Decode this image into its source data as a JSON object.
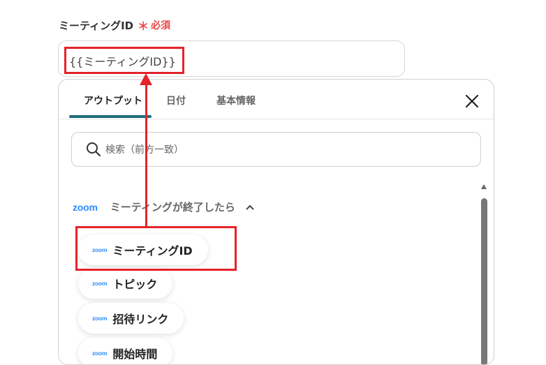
{
  "field": {
    "label": "ミーティングID",
    "required_mark": "＊",
    "required_text": "必須",
    "value": "{{ミーティングID}}"
  },
  "panel": {
    "tabs": [
      {
        "label": "アウトプット",
        "active": true
      },
      {
        "label": "日付",
        "active": false
      },
      {
        "label": "基本情報",
        "active": false
      }
    ],
    "search_placeholder": "検索（前方一致）",
    "group": {
      "logo": "zoom",
      "title": "ミーティングが終了したら",
      "expanded": true
    },
    "items": [
      {
        "logo": "zoom",
        "label": "ミーティングID"
      },
      {
        "logo": "zoom",
        "label": "トピック"
      },
      {
        "logo": "zoom",
        "label": "招待リンク"
      },
      {
        "logo": "zoom",
        "label": "開始時間"
      }
    ]
  },
  "colors": {
    "required": "#e8484a",
    "highlight": "#e5232a",
    "tab_underline": "#1e6b79",
    "zoom_brand": "#2d8cff"
  }
}
